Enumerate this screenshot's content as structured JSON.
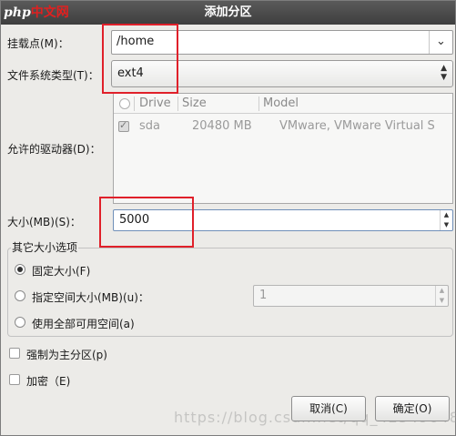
{
  "title": "添加分区",
  "logo": {
    "prefix": "php",
    "suffix": "中文网"
  },
  "mount_point": {
    "label": "挂载点(M)：",
    "value": "/home"
  },
  "fs_type": {
    "label": "文件系统类型(T)：",
    "value": "ext4"
  },
  "drives": {
    "label": "允许的驱动器(D)：",
    "columns": [
      "Drive",
      "Size",
      "Model"
    ],
    "rows": [
      {
        "drive": "sda",
        "size": "20480 MB",
        "model": "VMware, VMware Virtual S"
      }
    ]
  },
  "size": {
    "label": "大小(MB)(S)：",
    "value": "5000"
  },
  "other_size": {
    "title": "其它大小选项",
    "fixed": "固定大小(F)",
    "up_to": "指定空间大小(MB)(u)：",
    "up_to_value": "1",
    "fill": "使用全部可用空间(a)"
  },
  "force_primary": "强制为主分区(p)",
  "encrypt": "加密（E)",
  "buttons": {
    "cancel": "取消(C)",
    "ok": "确定(O)"
  },
  "watermark": "https://blog.csdn.net/qq_42549648",
  "colors": {
    "highlight": "#e0202a",
    "titlebar": "#4a4a4a"
  }
}
